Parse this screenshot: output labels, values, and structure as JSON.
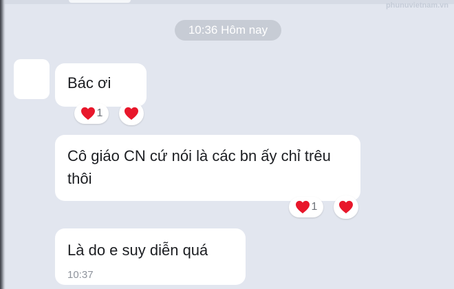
{
  "watermark": "phunuvietnam.vn",
  "time_separator": "10:36 Hôm nay",
  "messages": [
    {
      "text": "Bác ơi",
      "reactions": {
        "count_icon": "heart-icon",
        "count": "1",
        "add_icon": "heart-icon"
      }
    },
    {
      "text": "Cô giáo CN cứ nói là các bn ấy chỉ trêu thôi",
      "reactions": {
        "count_icon": "heart-icon",
        "count": "1",
        "add_icon": "heart-icon"
      }
    },
    {
      "text": "Là do e suy diễn quá",
      "time": "10:37"
    }
  ],
  "colors": {
    "background": "#e2e6ef",
    "bubble": "#ffffff",
    "heart": "#e8172b",
    "time_pill": "#c7ccd5"
  }
}
